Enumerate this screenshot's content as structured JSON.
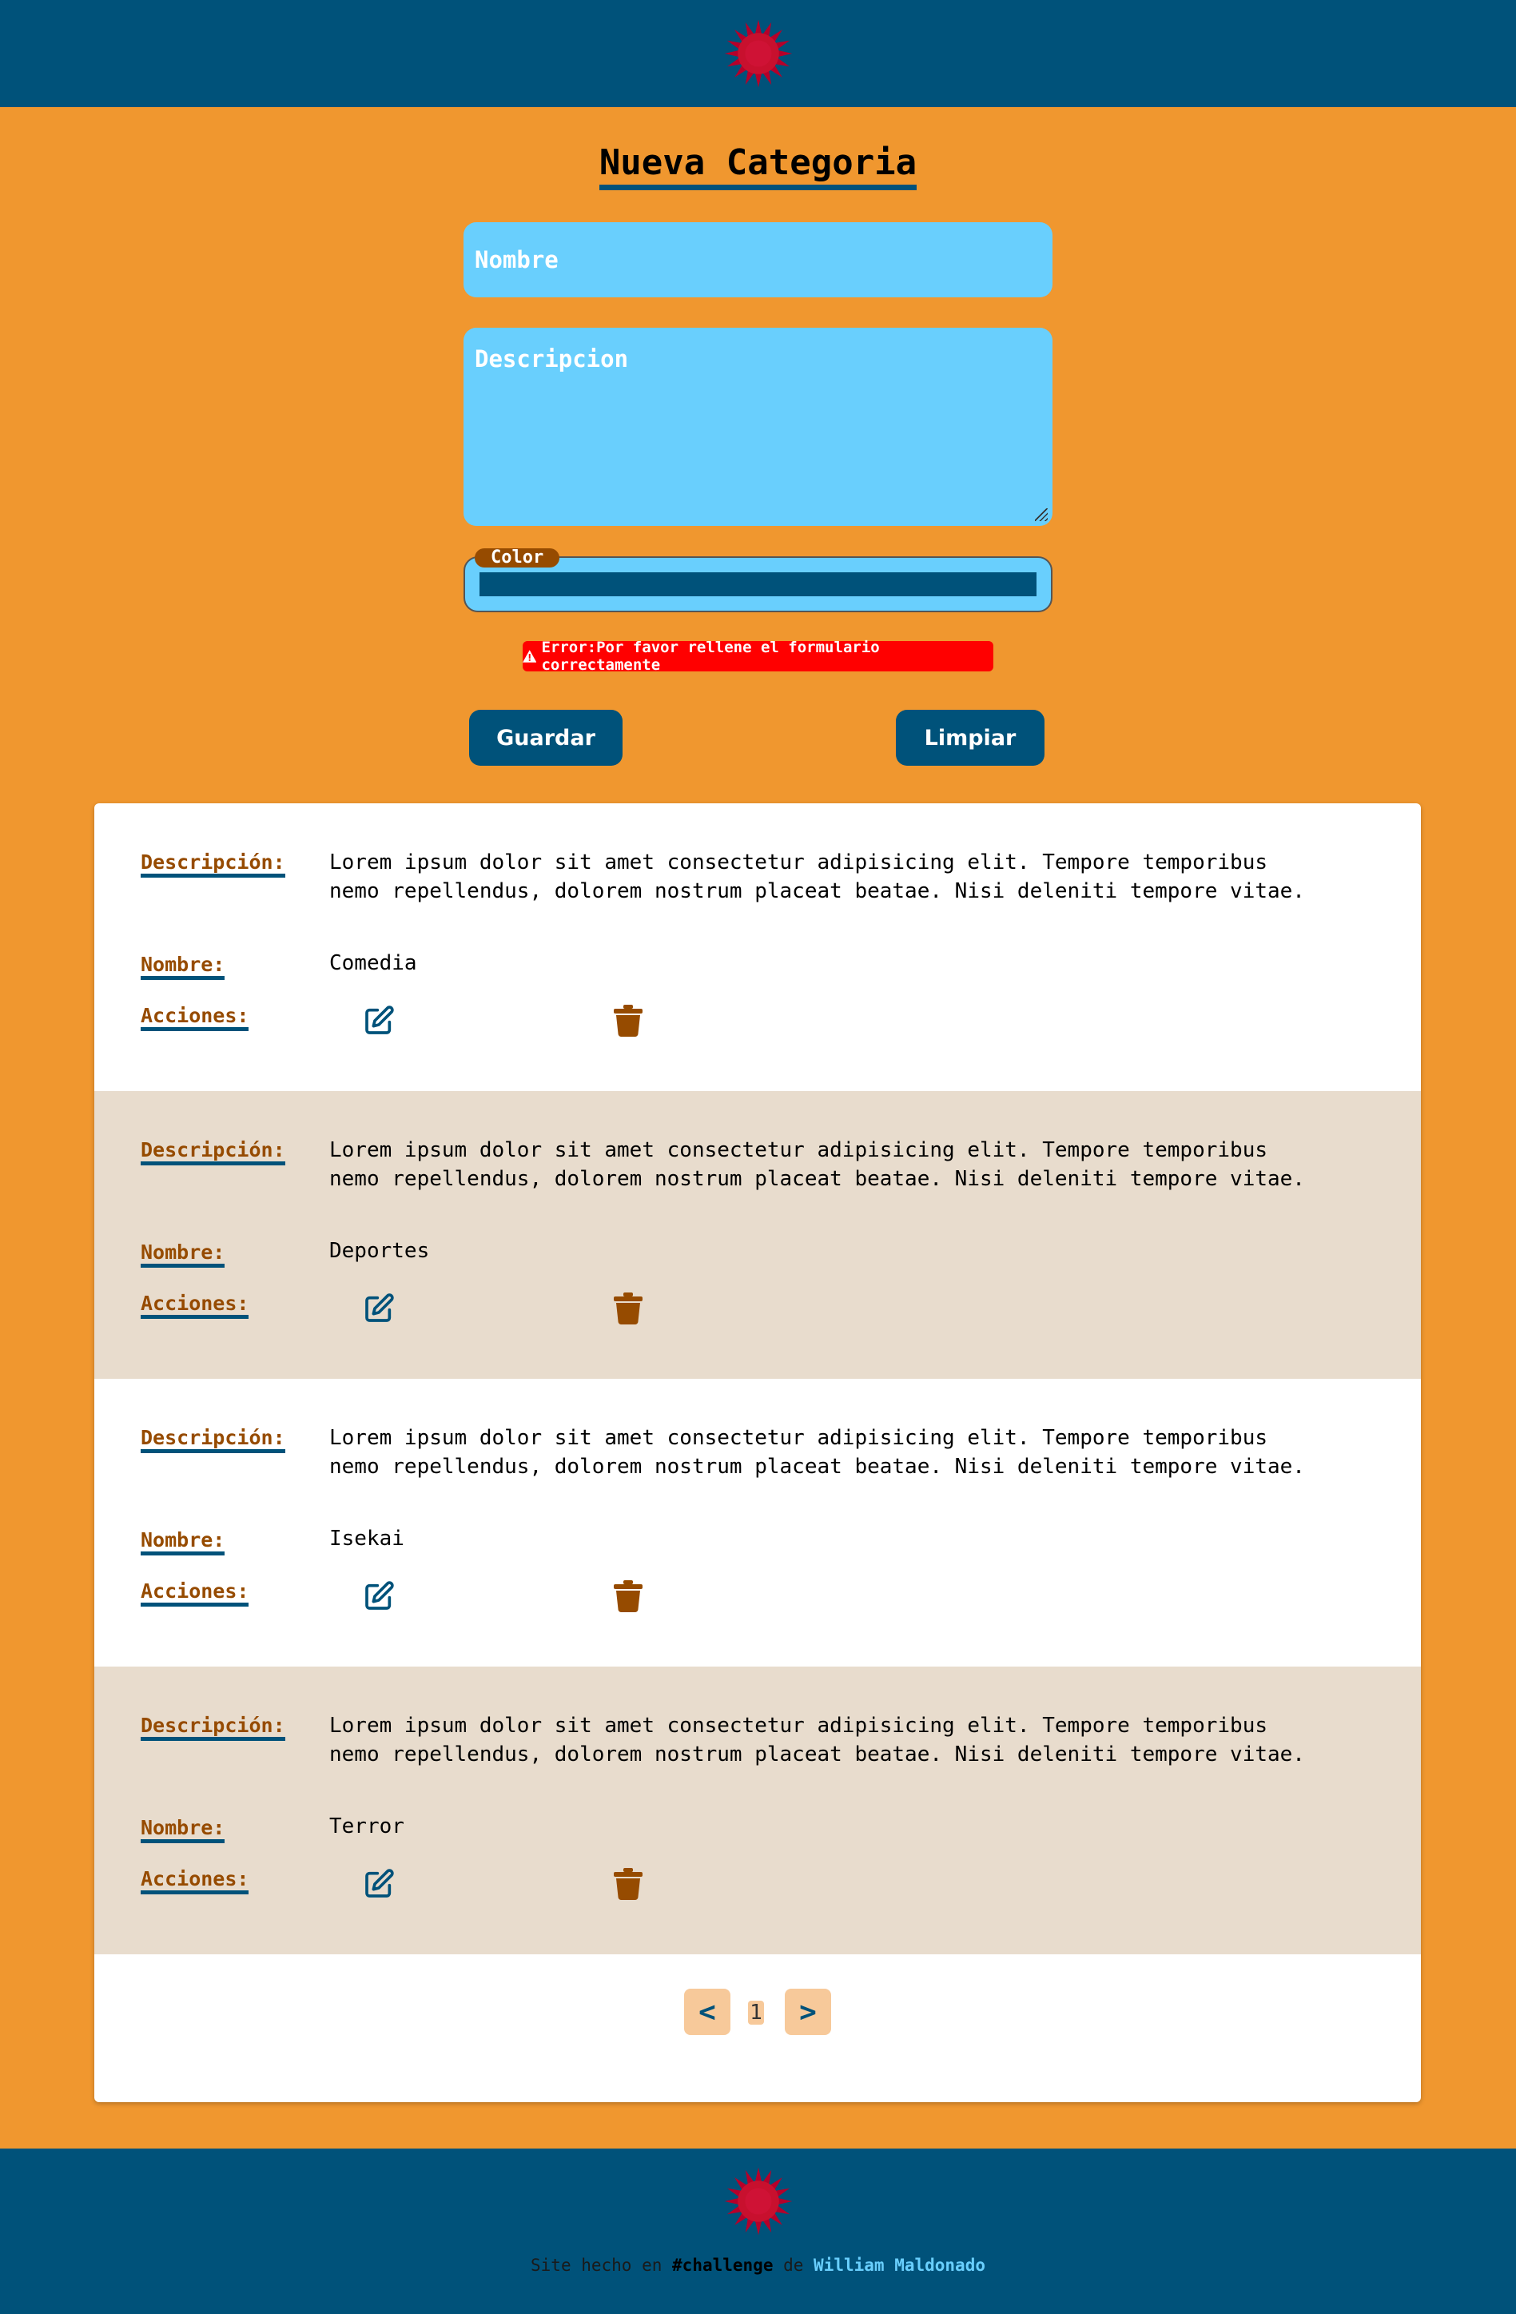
{
  "header": {
    "logo_icon": "red-sun-icon"
  },
  "form": {
    "title": "Nueva Categoria",
    "name_placeholder": "Nombre",
    "description_placeholder": "Descripcion",
    "color_label": "Color",
    "color_value": "#00527a",
    "error_text": "Error:Por favor rellene el formulario correctamente",
    "error_icon": "warning-triangle-icon",
    "save_label": "Guardar",
    "clear_label": "Limpiar"
  },
  "labels": {
    "description": "Descripción:",
    "name": "Nombre:",
    "actions": "Acciones:"
  },
  "categories": [
    {
      "description": "Lorem ipsum dolor sit amet consectetur adipisicing elit. Tempore temporibus nemo repellendus, dolorem nostrum placeat beatae. Nisi deleniti tempore vitae.",
      "name": "Comedia"
    },
    {
      "description": "Lorem ipsum dolor sit amet consectetur adipisicing elit. Tempore temporibus nemo repellendus, dolorem nostrum placeat beatae. Nisi deleniti tempore vitae.",
      "name": "Deportes"
    },
    {
      "description": "Lorem ipsum dolor sit amet consectetur adipisicing elit. Tempore temporibus nemo repellendus, dolorem nostrum placeat beatae. Nisi deleniti tempore vitae.",
      "name": "Isekai"
    },
    {
      "description": "Lorem ipsum dolor sit amet consectetur adipisicing elit. Tempore temporibus nemo repellendus, dolorem nostrum placeat beatae. Nisi deleniti tempore vitae.",
      "name": "Terror"
    }
  ],
  "pagination": {
    "prev": "<",
    "page": "1",
    "next": ">"
  },
  "footer": {
    "text_before": "Site hecho en ",
    "tag": "#challenge",
    "text_middle": " de ",
    "author": "William Maldonado"
  },
  "colors": {
    "background": "#f0972f",
    "header": "#00527a",
    "input": "#69cffd",
    "label": "#964b00",
    "alt_row": "#e8dccd",
    "error": "#ff0000"
  }
}
